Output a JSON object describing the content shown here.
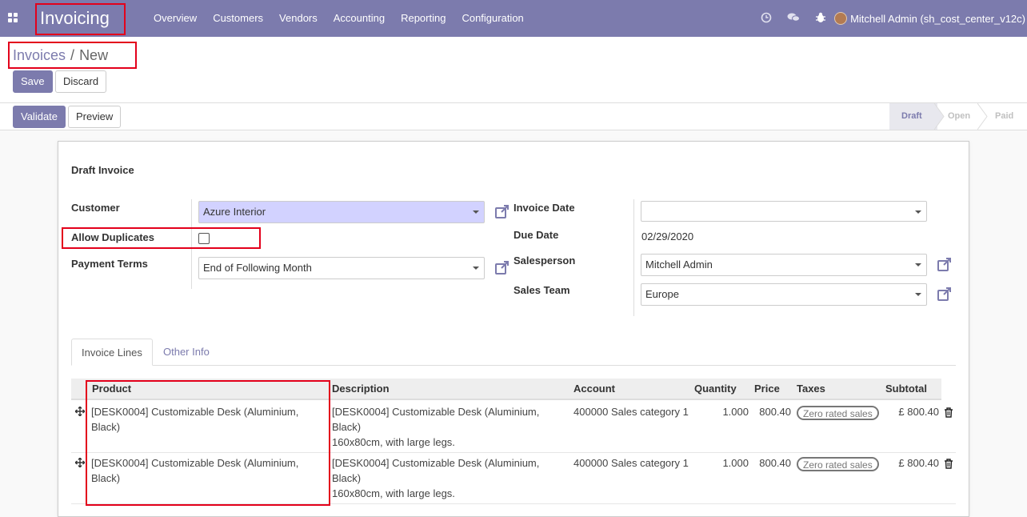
{
  "navbar": {
    "app_title": "Invoicing",
    "menu": [
      "Overview",
      "Customers",
      "Vendors",
      "Accounting",
      "Reporting",
      "Configuration"
    ],
    "user_label": "Mitchell Admin (sh_cost_center_v12c)"
  },
  "breadcrumb": {
    "parent": "Invoices",
    "separator": "/",
    "current": "New"
  },
  "buttons": {
    "save": "Save",
    "discard": "Discard",
    "validate": "Validate",
    "preview": "Preview"
  },
  "status": {
    "stages": [
      "Draft",
      "Open",
      "Paid"
    ],
    "active": "Draft"
  },
  "form": {
    "title": "Draft Invoice",
    "customer_label": "Customer",
    "customer_value": "Azure Interior",
    "allow_duplicates_label": "Allow Duplicates",
    "payment_terms_label": "Payment Terms",
    "payment_terms_value": "End of Following Month",
    "invoice_date_label": "Invoice Date",
    "invoice_date_value": "",
    "due_date_label": "Due Date",
    "due_date_value": "02/29/2020",
    "salesperson_label": "Salesperson",
    "salesperson_value": "Mitchell Admin",
    "sales_team_label": "Sales Team",
    "sales_team_value": "Europe"
  },
  "tabs": [
    "Invoice Lines",
    "Other Info"
  ],
  "table": {
    "headers": [
      "Product",
      "Description",
      "Account",
      "Quantity",
      "Price",
      "Taxes",
      "Subtotal"
    ],
    "rows": [
      {
        "product": "[DESK0004] Customizable Desk (Aluminium, Black)",
        "description": "[DESK0004] Customizable Desk (Aluminium, Black)",
        "description2": "160x80cm, with large legs.",
        "account": "400000 Sales category 1",
        "quantity": "1.000",
        "price": "800.40",
        "tax": "Zero rated sales",
        "subtotal": "£ 800.40"
      },
      {
        "product": "[DESK0004] Customizable Desk (Aluminium, Black)",
        "description": "[DESK0004] Customizable Desk (Aluminium, Black)",
        "description2": "160x80cm, with large legs.",
        "account": "400000 Sales category 1",
        "quantity": "1.000",
        "price": "800.40",
        "tax": "Zero rated sales",
        "subtotal": "£ 800.40"
      }
    ]
  },
  "colors": {
    "brand": "#7c7bad",
    "highlight": "#e3001b",
    "required_field": "#d2d2ff"
  }
}
